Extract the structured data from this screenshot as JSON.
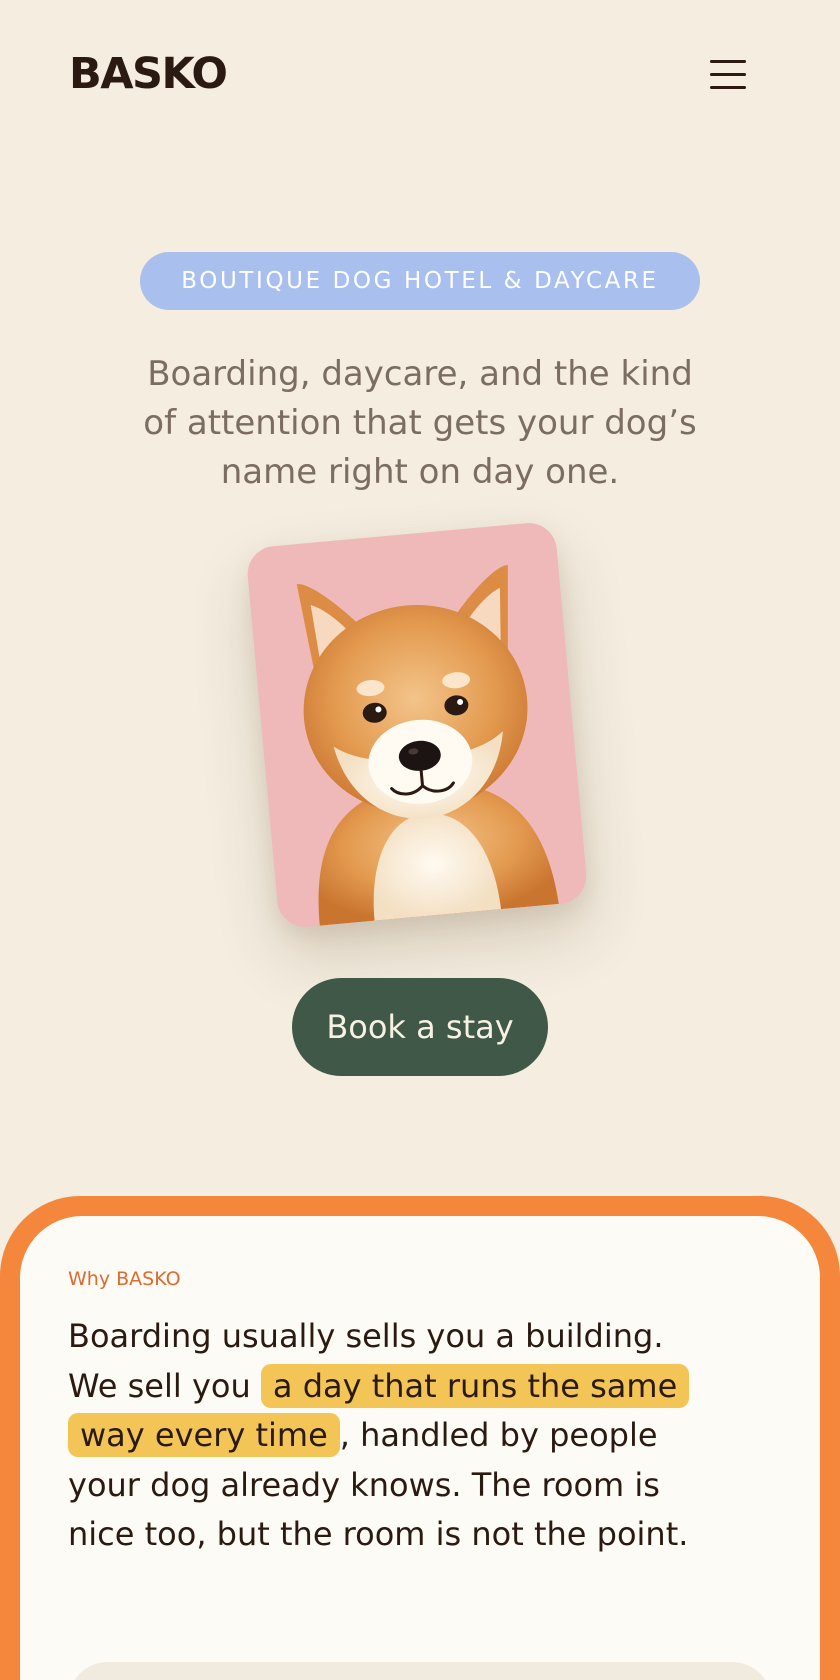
{
  "header": {
    "brand": "BASKO",
    "menu_icon": "hamburger-menu-icon"
  },
  "hero": {
    "badge": "BOUTIQUE DOG HOTEL & DAYCARE",
    "tagline": "Boarding, daycare, and the kind of attention that gets your dog’s name right on day one.",
    "photo_alt": "Shiba Inu dog portrait on pink background",
    "cta_label": "Book a stay"
  },
  "why": {
    "label": "Why BASKO",
    "body_before": "Boarding usually sells you a building. We sell you ",
    "body_highlight": "a day that runs the same way every time",
    "body_after": ", handled by people your dog already knows. The room is nice too, but the room is not the point."
  },
  "colors": {
    "background": "#f4ede0",
    "badge": "#a9bfee",
    "cta": "#3f5848",
    "accent_orange": "#f5873c",
    "highlight": "#f3c556",
    "photo_bg": "#eeb9b8"
  }
}
